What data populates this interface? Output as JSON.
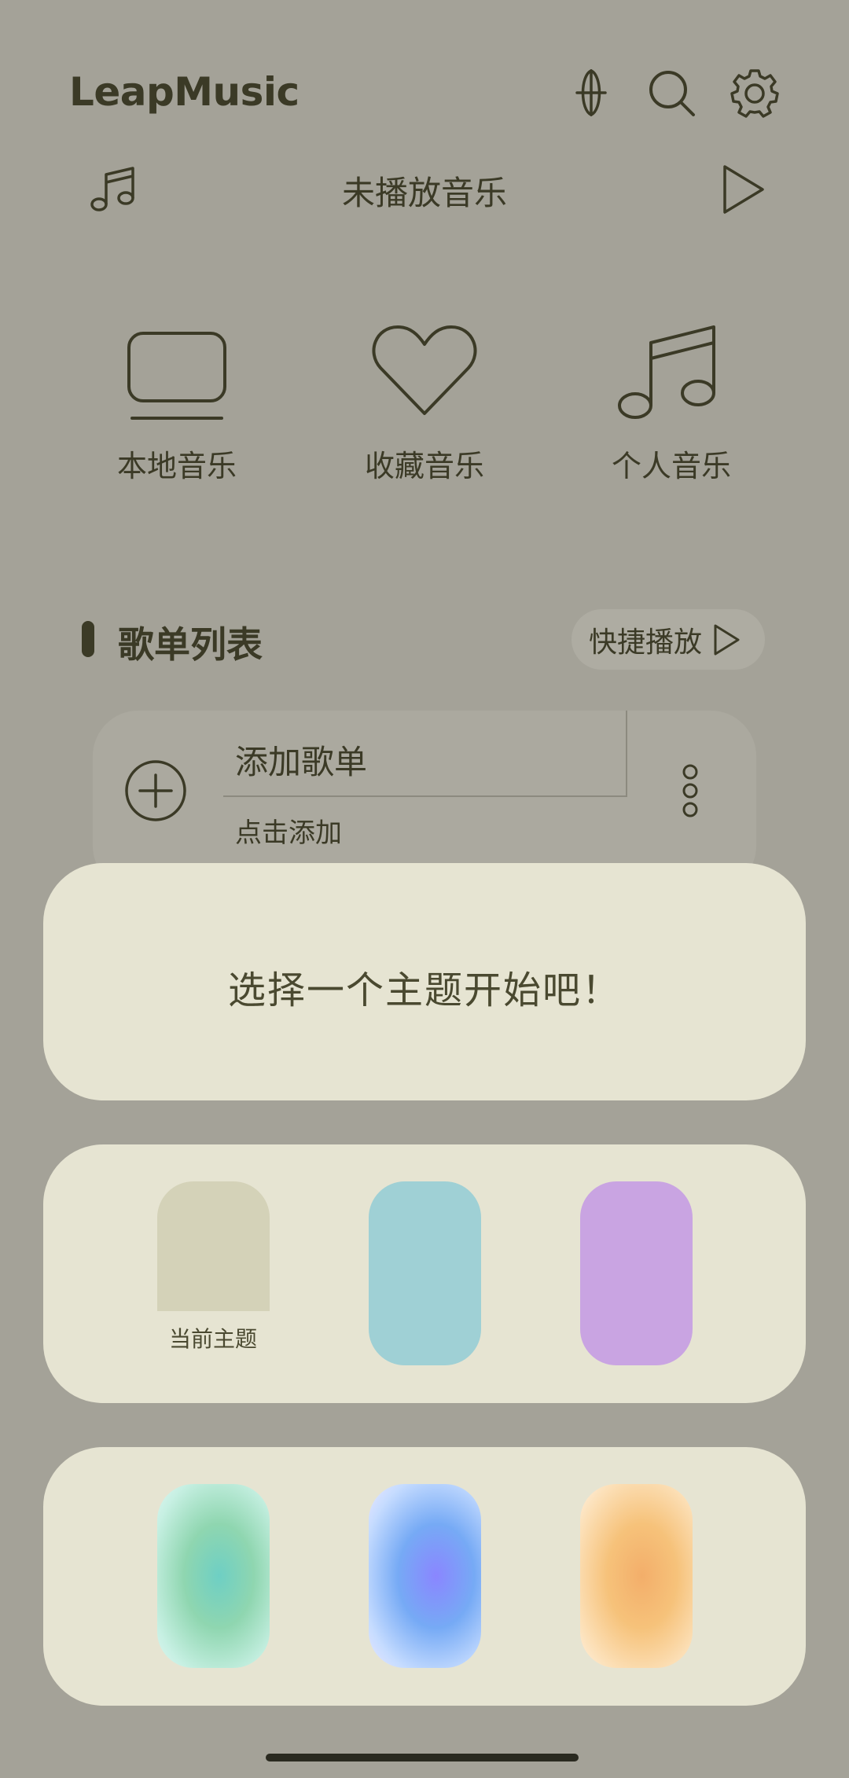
{
  "header": {
    "title": "LeapMusic",
    "icons": [
      "sort-icon",
      "search-icon",
      "gear-icon"
    ]
  },
  "now_playing": {
    "title": "未播放音乐",
    "icons": [
      "music-note-icon",
      "play-icon"
    ]
  },
  "categories": [
    {
      "label": "本地音乐",
      "icon": "monitor-icon"
    },
    {
      "label": "收藏音乐",
      "icon": "heart-icon"
    },
    {
      "label": "个人音乐",
      "icon": "music-notes-icon"
    }
  ],
  "playlist": {
    "title": "歌单列表",
    "quick_play_label": "快捷播放",
    "add_item": {
      "title": "添加歌单",
      "subtitle": "点击添加"
    }
  },
  "theme_sheet": {
    "title": "选择一个主题开始吧！",
    "current_label": "当前主题",
    "solid_themes": [
      "#d4d2b8",
      "#9fd0d5",
      "#c9a4e2"
    ],
    "gradient_themes": [
      "green-teal",
      "blue-violet",
      "orange-peach"
    ]
  },
  "colors": {
    "background": "#a4a298",
    "sheet": "#e6e4d2",
    "text": "#3b3a26"
  }
}
